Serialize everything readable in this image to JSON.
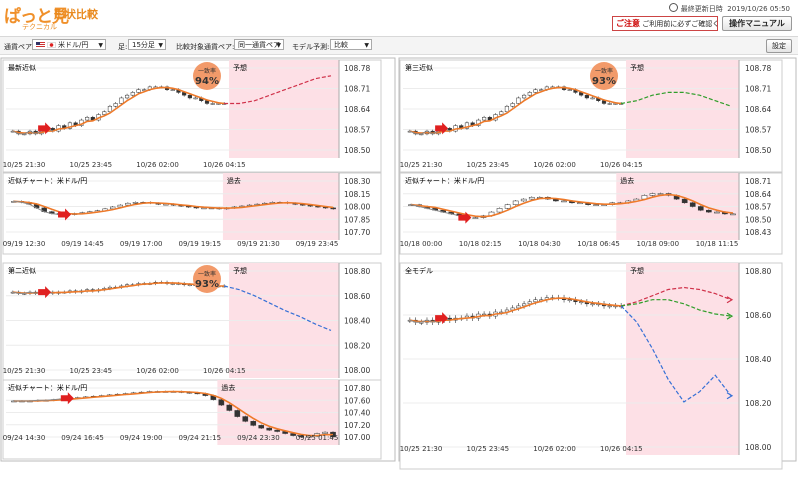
{
  "app": {
    "logo_text": "ぱっと見",
    "logo_subtitle": "形状比較",
    "logo_caption": "テクニカル",
    "last_updated_label": "最終更新日時",
    "last_updated": "2019/10/26 05:50",
    "notice_title": "ご注意",
    "notice_text": "ご利用前に必ずご確認ください",
    "manual_button": "操作マニュアル"
  },
  "controls": {
    "pair_label": "通貨ペア:",
    "pair_value": "米ドル/円",
    "timeframe_label": "足:",
    "timeframe_value": "15分足",
    "compare_label": "比較対象通貨ペア:",
    "compare_value": "同一通貨ペア",
    "model_label": "モデル予測:",
    "model_value": "比較",
    "settings_button": "設定"
  },
  "badges": {
    "label": "一致率",
    "forecast": "予想",
    "past": "過去"
  },
  "colors": {
    "forecast_zone": "#fde0e6",
    "badge": "#f29a6a",
    "ma_line": "#ee7a2a",
    "up_candle": "#ffffff",
    "down_candle": "#333333",
    "red_forecast": "#d0324a",
    "green_forecast": "#2f9e2a",
    "blue_forecast": "#3670d6",
    "arrow": "#e02020",
    "past_highlight": "#545488"
  },
  "chart_data": [
    {
      "type": "candlestick",
      "title": "最新近似",
      "yticks": [
        "108.78",
        "108.71",
        "108.64",
        "108.57",
        "108.50"
      ],
      "xticks": [
        "10/25 21:30",
        "10/25 23:45",
        "10/26 02:00",
        "10/26 04:15"
      ],
      "badge": "94%",
      "series": [
        {
          "values": [
            108.56,
            108.55,
            108.55,
            108.56,
            108.55,
            108.56,
            108.57,
            108.56,
            108.58,
            108.57,
            108.59,
            108.58,
            108.6,
            108.61,
            108.6,
            108.62,
            108.63,
            108.65,
            108.66,
            108.68,
            108.69,
            108.7,
            108.71,
            108.71,
            108.72,
            108.72,
            108.72,
            108.71,
            108.71,
            108.7,
            108.69,
            108.68,
            108.68,
            108.67,
            108.66,
            108.66,
            108.66,
            108.66
          ]
        }
      ],
      "forecasts": [
        {
          "color": "red",
          "values": [
            108.66,
            108.66,
            108.67,
            108.69,
            108.71,
            108.73,
            108.75,
            108.76
          ]
        }
      ],
      "ylim": [
        108.47,
        108.81
      ]
    },
    {
      "type": "candlestick",
      "title": "近似チャート：米ドル/円",
      "yticks": [
        "108.30",
        "108.15",
        "108.00",
        "107.85",
        "107.70"
      ],
      "xticks": [
        "09/19 12:30",
        "09/19 14:45",
        "09/19 17:00",
        "09/19 19:15",
        "09/19 21:30",
        "09/19 23:45"
      ],
      "series": [
        {
          "values": [
            108.05,
            108.04,
            108.02,
            107.98,
            107.94,
            107.92,
            107.91,
            107.91,
            107.92,
            107.93,
            107.94,
            107.95,
            107.97,
            107.99,
            108.01,
            108.03,
            108.04,
            108.04,
            108.03,
            108.02,
            108.02,
            108.01,
            108.0,
            107.99,
            107.98,
            107.98,
            107.98,
            107.97,
            107.98,
            107.99,
            108.0,
            108.01,
            108.02,
            108.03,
            108.04,
            108.04,
            108.03,
            108.02,
            108.01,
            108.0,
            107.99,
            107.98,
            107.97
          ]
        }
      ],
      "past_start_index": 28,
      "ylim": [
        107.66,
        108.33
      ]
    },
    {
      "type": "candlestick",
      "title": "第三近似",
      "yticks": [
        "108.78",
        "108.71",
        "108.64",
        "108.57",
        "108.50"
      ],
      "xticks": [
        "10/25 21:30",
        "10/25 23:45",
        "10/26 02:00",
        "10/26 04:15"
      ],
      "badge": "93%",
      "series": [
        {
          "values": [
            108.56,
            108.55,
            108.55,
            108.56,
            108.55,
            108.56,
            108.57,
            108.56,
            108.58,
            108.57,
            108.59,
            108.58,
            108.6,
            108.61,
            108.6,
            108.62,
            108.63,
            108.65,
            108.66,
            108.68,
            108.69,
            108.7,
            108.71,
            108.71,
            108.72,
            108.72,
            108.72,
            108.71,
            108.71,
            108.7,
            108.69,
            108.68,
            108.68,
            108.67,
            108.66,
            108.66,
            108.66,
            108.66
          ]
        }
      ],
      "forecasts": [
        {
          "color": "green",
          "values": [
            108.66,
            108.67,
            108.69,
            108.7,
            108.7,
            108.69,
            108.67,
            108.65
          ]
        }
      ],
      "ylim": [
        108.47,
        108.81
      ]
    },
    {
      "type": "candlestick",
      "title": "近似チャート：米ドル/円",
      "yticks": [
        "108.71",
        "108.64",
        "108.57",
        "108.50",
        "108.43"
      ],
      "xticks": [
        "10/18 00:00",
        "10/18 02:15",
        "10/18 04:30",
        "10/18 06:45",
        "10/18 09:00",
        "10/18 11:15"
      ],
      "series": [
        {
          "values": [
            108.58,
            108.57,
            108.56,
            108.55,
            108.54,
            108.53,
            108.52,
            108.51,
            108.51,
            108.52,
            108.54,
            108.56,
            108.58,
            108.6,
            108.61,
            108.62,
            108.62,
            108.61,
            108.6,
            108.6,
            108.59,
            108.59,
            108.58,
            108.58,
            108.58,
            108.59,
            108.59,
            108.6,
            108.61,
            108.63,
            108.64,
            108.64,
            108.63,
            108.61,
            108.59,
            108.57,
            108.55,
            108.54,
            108.54,
            108.53,
            108.53
          ]
        }
      ],
      "past_start_index": 26,
      "ylim": [
        108.4,
        108.74
      ]
    },
    {
      "type": "candlestick",
      "title": "第二近似",
      "yticks": [
        "108.80",
        "108.60",
        "108.40",
        "108.20",
        "108.00"
      ],
      "xticks": [
        "10/25 21:30",
        "10/25 23:45",
        "10/26 02:00",
        "10/26 04:15"
      ],
      "badge": "93%",
      "series": [
        {
          "values": [
            108.64,
            108.63,
            108.63,
            108.64,
            108.63,
            108.64,
            108.64,
            108.63,
            108.64,
            108.64,
            108.65,
            108.64,
            108.65,
            108.66,
            108.65,
            108.66,
            108.67,
            108.68,
            108.68,
            108.69,
            108.7,
            108.7,
            108.71,
            108.71,
            108.71,
            108.72,
            108.72,
            108.71,
            108.71,
            108.71,
            108.7,
            108.7,
            108.7,
            108.69,
            108.69,
            108.69,
            108.69,
            108.69
          ]
        }
      ],
      "forecasts": [
        {
          "color": "blue",
          "values": [
            108.69,
            108.66,
            108.61,
            108.55,
            108.49,
            108.44,
            108.38,
            108.33
          ]
        }
      ],
      "ylim": [
        107.96,
        108.86
      ]
    },
    {
      "type": "candlestick",
      "title": "近似チャート：米ドル/円",
      "yticks": [
        "107.80",
        "107.60",
        "107.40",
        "107.20",
        "107.00"
      ],
      "xticks": [
        "09/24 14:30",
        "09/24 16:45",
        "09/24 19:00",
        "09/24 21:15",
        "09/24 23:30",
        "09/25 01:45"
      ],
      "series": [
        {
          "values": [
            107.58,
            107.58,
            107.58,
            107.59,
            107.59,
            107.6,
            107.61,
            107.62,
            107.63,
            107.64,
            107.65,
            107.66,
            107.67,
            107.68,
            107.69,
            107.7,
            107.71,
            107.72,
            107.72,
            107.72,
            107.72,
            107.71,
            107.7,
            107.69,
            107.66,
            107.6,
            107.52,
            107.44,
            107.35,
            107.28,
            107.22,
            107.18,
            107.15,
            107.13,
            107.1,
            107.07,
            107.05,
            107.06,
            107.1,
            107.12,
            107.05
          ]
        }
      ],
      "past_start_index": 26,
      "ylim": [
        106.96,
        107.86
      ]
    },
    {
      "type": "candlestick",
      "title": "全モデル",
      "yticks": [
        "108.80",
        "108.60",
        "108.40",
        "108.20",
        "108.00"
      ],
      "xticks": [
        "10/25 21:30",
        "10/25 23:45",
        "10/26 02:00",
        "10/26 04:15"
      ],
      "series": [
        {
          "values": [
            108.59,
            108.58,
            108.58,
            108.59,
            108.58,
            108.59,
            108.6,
            108.59,
            108.6,
            108.6,
            108.61,
            108.6,
            108.62,
            108.62,
            108.61,
            108.63,
            108.63,
            108.64,
            108.65,
            108.66,
            108.67,
            108.68,
            108.69,
            108.69,
            108.7,
            108.7,
            108.7,
            108.69,
            108.69,
            108.68,
            108.68,
            108.67,
            108.67,
            108.67,
            108.66,
            108.66,
            108.66,
            108.66
          ]
        }
      ],
      "forecasts": [
        {
          "color": "red",
          "values": [
            108.66,
            108.68,
            108.71,
            108.74,
            108.75,
            108.74,
            108.72,
            108.69
          ]
        },
        {
          "color": "green",
          "values": [
            108.66,
            108.67,
            108.69,
            108.69,
            108.67,
            108.64,
            108.62,
            108.61
          ]
        },
        {
          "color": "blue",
          "values": [
            108.66,
            108.58,
            108.45,
            108.3,
            108.19,
            108.24,
            108.32,
            108.22
          ]
        }
      ],
      "ylim": [
        107.94,
        108.86
      ]
    }
  ]
}
